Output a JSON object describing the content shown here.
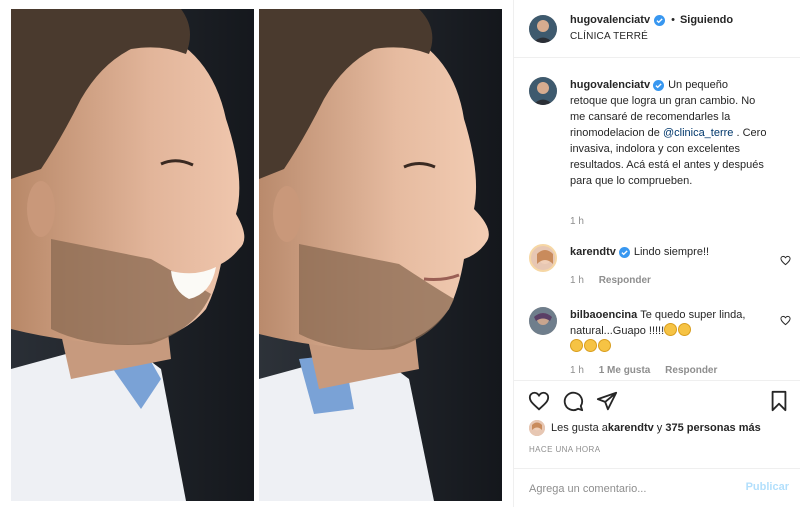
{
  "post": {
    "author": "hugovalenciatv",
    "follow_status": "Siguiendo",
    "location": "CLÍNICA TERRÉ",
    "separator": "•"
  },
  "caption": {
    "username": "hugovalenciatv",
    "text_before": "Un pequeño retoque que logra un gran cambio. No me cansaré de recomendarles la rinomodelacion de ",
    "mention": "@clinica_terre",
    "text_after": " . Cero invasiva, indolora y con excelentes resultados. Acá está el antes y después para que lo comprueben.",
    "time": "1 h"
  },
  "comments": [
    {
      "username": "karendtv",
      "text": "Lindo siempre!!",
      "time": "1 h",
      "reply_label": "Responder"
    },
    {
      "username": "bilbaoencina",
      "text": "Te quedo super linda, natural...Guapo !!!!!",
      "time": "1 h",
      "likes_label": "1 Me gusta",
      "reply_label": "Responder"
    }
  ],
  "likes": {
    "prefix": "Les gusta a ",
    "first_user": "karendtv",
    "joiner": " y ",
    "others": "375 personas más"
  },
  "timestamp": "HACE UNA HORA",
  "composer": {
    "placeholder": "Agrega un comentario...",
    "post_label": "Publicar"
  },
  "icons": {
    "verified": "verified-badge-icon",
    "like": "heart-icon",
    "comment": "comment-bubble-icon",
    "share": "paper-plane-icon",
    "save": "bookmark-icon"
  },
  "colors": {
    "verified_blue": "#3897f0",
    "link_blue": "#00376b",
    "publish_disabled": "#b2dffc",
    "muted_text": "#8e8e8e",
    "photo_background": "#1c2026"
  }
}
